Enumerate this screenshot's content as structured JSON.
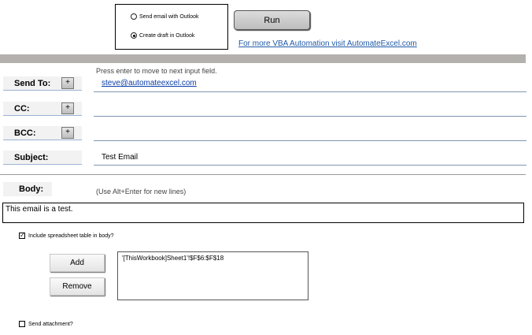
{
  "options": {
    "send_label": "Send email with Outlook",
    "draft_label": "Create draft in Outlook",
    "selected": "draft"
  },
  "run_label": "Run",
  "vba_link": "For more VBA Automation visit AutomateExcel.com",
  "hint_enter": "Press enter to move to next input field.",
  "fields": {
    "send_to": {
      "label": "Send To:",
      "value": "steve@automateexcel.com"
    },
    "cc": {
      "label": "CC:",
      "value": ""
    },
    "bcc": {
      "label": "BCC:",
      "value": ""
    },
    "subject": {
      "label": "Subject:",
      "value": "Test Email"
    }
  },
  "plus_glyph": "+",
  "body": {
    "label": "Body:",
    "hint": "(Use Alt+Enter for new lines)",
    "value": "This email is a test."
  },
  "include_table": {
    "label": "Include spreadsheet table in body?",
    "checked": true
  },
  "add_label": "Add",
  "remove_label": "Remove",
  "range_items": [
    "'[ThisWorkbook]Sheet1'!$F$6:$F$18"
  ],
  "attachment": {
    "label": "Send attachment?",
    "checked": false
  },
  "colors": {
    "link": "#1f5aa8",
    "bar": "#b3b0ad",
    "field_line": "#7f96b0"
  }
}
